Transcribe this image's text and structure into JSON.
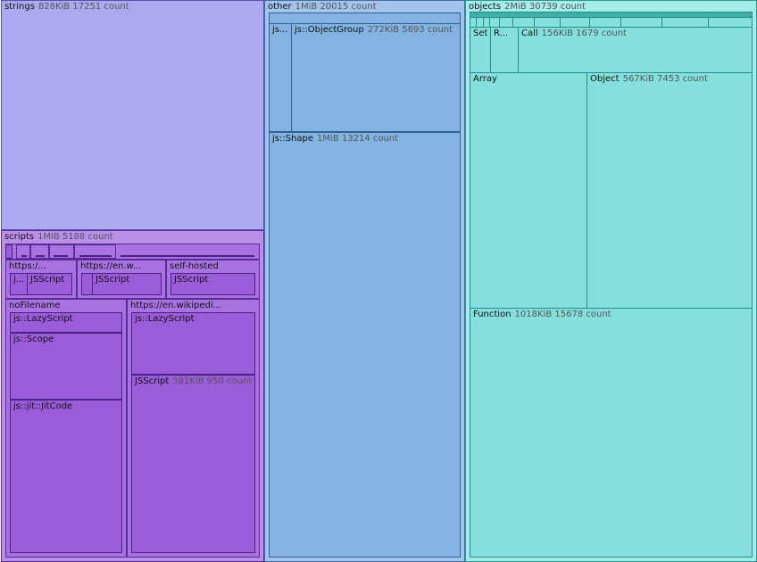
{
  "groups": {
    "strings": {
      "name": "strings",
      "meta": "828KiB 17251 count"
    },
    "scripts": {
      "name": "scripts",
      "meta": "1MiB 5188 count",
      "sources": {
        "s1": {
          "name": "https:/..."
        },
        "s1a": {
          "name": "j..."
        },
        "s1b": {
          "name": "JSScript"
        },
        "s2": {
          "name": "https://en.w..."
        },
        "s2b": {
          "name": "JSScript"
        },
        "s3": {
          "name": "self-hosted"
        },
        "s3b": {
          "name": "JSScript"
        },
        "nofile": {
          "name": "noFilename"
        },
        "nofile_lazy": {
          "name": "js::LazyScript"
        },
        "nofile_scope": {
          "name": "js::Scope"
        },
        "nofile_jit": {
          "name": "js::jit::JitCode"
        },
        "wiki": {
          "name": "https://en.wikipedi..."
        },
        "wiki_lazy": {
          "name": "js::LazyScript"
        },
        "wiki_jsscript": {
          "name": "JSScript",
          "meta": "381KiB 950 count"
        }
      }
    },
    "other": {
      "name": "other",
      "meta": "1MiB 20015 count",
      "js_small": {
        "name": "js..."
      },
      "objectgroup": {
        "name": "js::ObjectGroup",
        "meta": "272KiB 5693 count"
      },
      "shape": {
        "name": "js::Shape",
        "meta": "1MiB 13214 count"
      }
    },
    "objects": {
      "name": "objects",
      "meta": "2MiB 30739 count",
      "set": {
        "name": "Set"
      },
      "r": {
        "name": "R..."
      },
      "call": {
        "name": "Call",
        "meta": "156KiB 1679 count"
      },
      "array": {
        "name": "Array"
      },
      "object": {
        "name": "Object",
        "meta": "567KiB 7453 count"
      },
      "function": {
        "name": "Function",
        "meta": "1018KiB 15678 count"
      }
    }
  },
  "colors": {
    "strings": "#acaaee",
    "scripts": "#b98fe8",
    "other": "#a4c4ec",
    "objects": "#a6ece8"
  }
}
